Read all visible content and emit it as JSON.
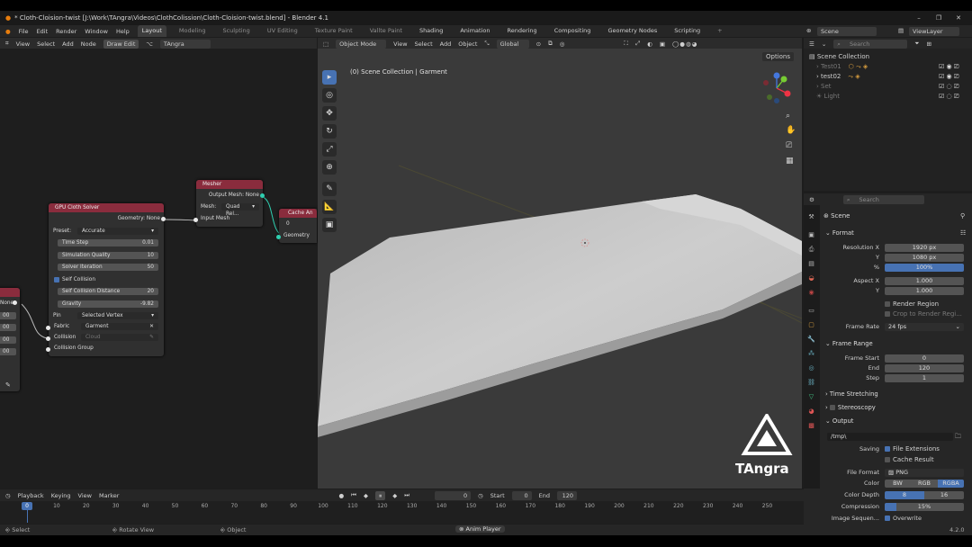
{
  "window": {
    "title": "* Cloth-Cloision-twist [J:\\Work\\TAngra\\Videos\\ClothColission\\Cloth-Cloision-twist.blend] - Blender 4.1",
    "minimize": "–",
    "maximize": "❐",
    "close": "✕"
  },
  "menu": {
    "items": [
      "File",
      "Edit",
      "Render",
      "Window",
      "Help"
    ],
    "workspaces": [
      "Layout",
      "Modeling",
      "Sculpting",
      "UV Editing",
      "Texture Paint",
      "Vallte Paint",
      "Shading",
      "Animation",
      "Rendering",
      "Compositing",
      "Geometry Nodes",
      "Scripting",
      "+"
    ],
    "active_workspace": "Layout"
  },
  "scene_selector": {
    "scene": "Scene",
    "view_layer": "ViewLayer"
  },
  "node_editor": {
    "header": [
      "View",
      "Select",
      "Add",
      "Node"
    ],
    "draw_edit": "Draw Edit",
    "tree_name": "TAngra",
    "left_node": {
      "label": "None",
      "values": [
        "00",
        "00",
        "00",
        "00"
      ]
    },
    "cloth_solver": {
      "title": "GPU Cloth Solver",
      "geometry_label": "Geometry: None",
      "preset_label": "Preset:",
      "preset_value": "Accurate",
      "fields": [
        {
          "label": "Time Step",
          "value": "0.01"
        },
        {
          "label": "Simulation Quality",
          "value": "10"
        },
        {
          "label": "Solver Iteration",
          "value": "50"
        }
      ],
      "self_collision": "Self Collision",
      "fields2": [
        {
          "label": "Self Collision Distance",
          "value": "20"
        },
        {
          "label": "Gravity",
          "value": "-9.82"
        }
      ],
      "pin_label": "Pin",
      "pin_value": "Selected Vertex",
      "fabric_label": "Fabric",
      "fabric_value": "Garment",
      "collision_label": "Collision",
      "collision_placeholder": "Cloud",
      "collision_group": "Collision Group"
    },
    "mesher": {
      "title": "Mesher",
      "output": "Output Mesh: None",
      "mesh_label": "Mesh:",
      "mesh_value": "Quad Rel...",
      "input": "Input Mesh"
    },
    "cache": {
      "title": "Cache An",
      "slot": "0",
      "geometry": "Geometry"
    }
  },
  "viewport": {
    "header": [
      "View",
      "Select",
      "Add",
      "Object"
    ],
    "mode": "Object Mode",
    "orientation": "Global",
    "options": "Options",
    "info": "(0) Scene Collection | Garment",
    "brand": "TAngra"
  },
  "outliner": {
    "search_placeholder": "Search",
    "items": [
      "Scene Collection",
      "Test01",
      "test02",
      "Set",
      "Light"
    ]
  },
  "properties": {
    "search_placeholder": "Search",
    "scene": "Scene",
    "format_section": "Format",
    "res_x_label": "Resolution X",
    "res_x": "1920 px",
    "res_y_label": "Y",
    "res_y": "1080 px",
    "pct_label": "%",
    "pct": "100%",
    "aspect_x_label": "Aspect X",
    "aspect_x": "1.000",
    "aspect_y_label": "Y",
    "aspect_y": "1.000",
    "render_region": "Render Region",
    "crop": "Crop to Render Regi...",
    "frame_rate_label": "Frame Rate",
    "frame_rate": "24 fps",
    "frame_range_section": "Frame Range",
    "frame_start_label": "Frame Start",
    "frame_start": "0",
    "end_label": "End",
    "end": "120",
    "step_label": "Step",
    "step": "1",
    "time_stretching": "Time Stretching",
    "stereoscopy": "Stereoscopy",
    "output_section": "Output",
    "output_path": "/tmp\\",
    "saving_label": "Saving",
    "file_extensions": "File Extensions",
    "cache_result": "Cache Result",
    "file_format_label": "File Format",
    "file_format": "PNG",
    "color_label": "Color",
    "color_bw": "BW",
    "color_rgb": "RGB",
    "color_rgba": "RGBA",
    "depth_label": "Color Depth",
    "depth_8": "8",
    "depth_16": "16",
    "compression_label": "Compression",
    "compression": "15%",
    "compression_level": 0.15,
    "image_seq_label": "Image Sequen...",
    "overwrite": "Overwrite",
    "version": "4.2.0"
  },
  "timeline": {
    "header": [
      "Playback",
      "Keying",
      "View",
      "Marker"
    ],
    "current_frame": "0",
    "start_label": "Start",
    "start": "0",
    "end_label": "End",
    "end": "120",
    "ticks": [
      "0",
      "10",
      "20",
      "30",
      "40",
      "50",
      "60",
      "70",
      "80",
      "90",
      "100",
      "110",
      "120",
      "130",
      "140",
      "150",
      "160",
      "170",
      "180",
      "190",
      "200",
      "210",
      "220",
      "230",
      "240",
      "250"
    ]
  },
  "status": {
    "select": "Select",
    "rotate": "Rotate View",
    "object": "Object",
    "player": "Anim Player"
  },
  "colors": {
    "node_header": "#8a2c3d",
    "accent": "#4772b3",
    "viewport_bg": "#3a3a3a",
    "cloth": "#c8c8c8"
  }
}
